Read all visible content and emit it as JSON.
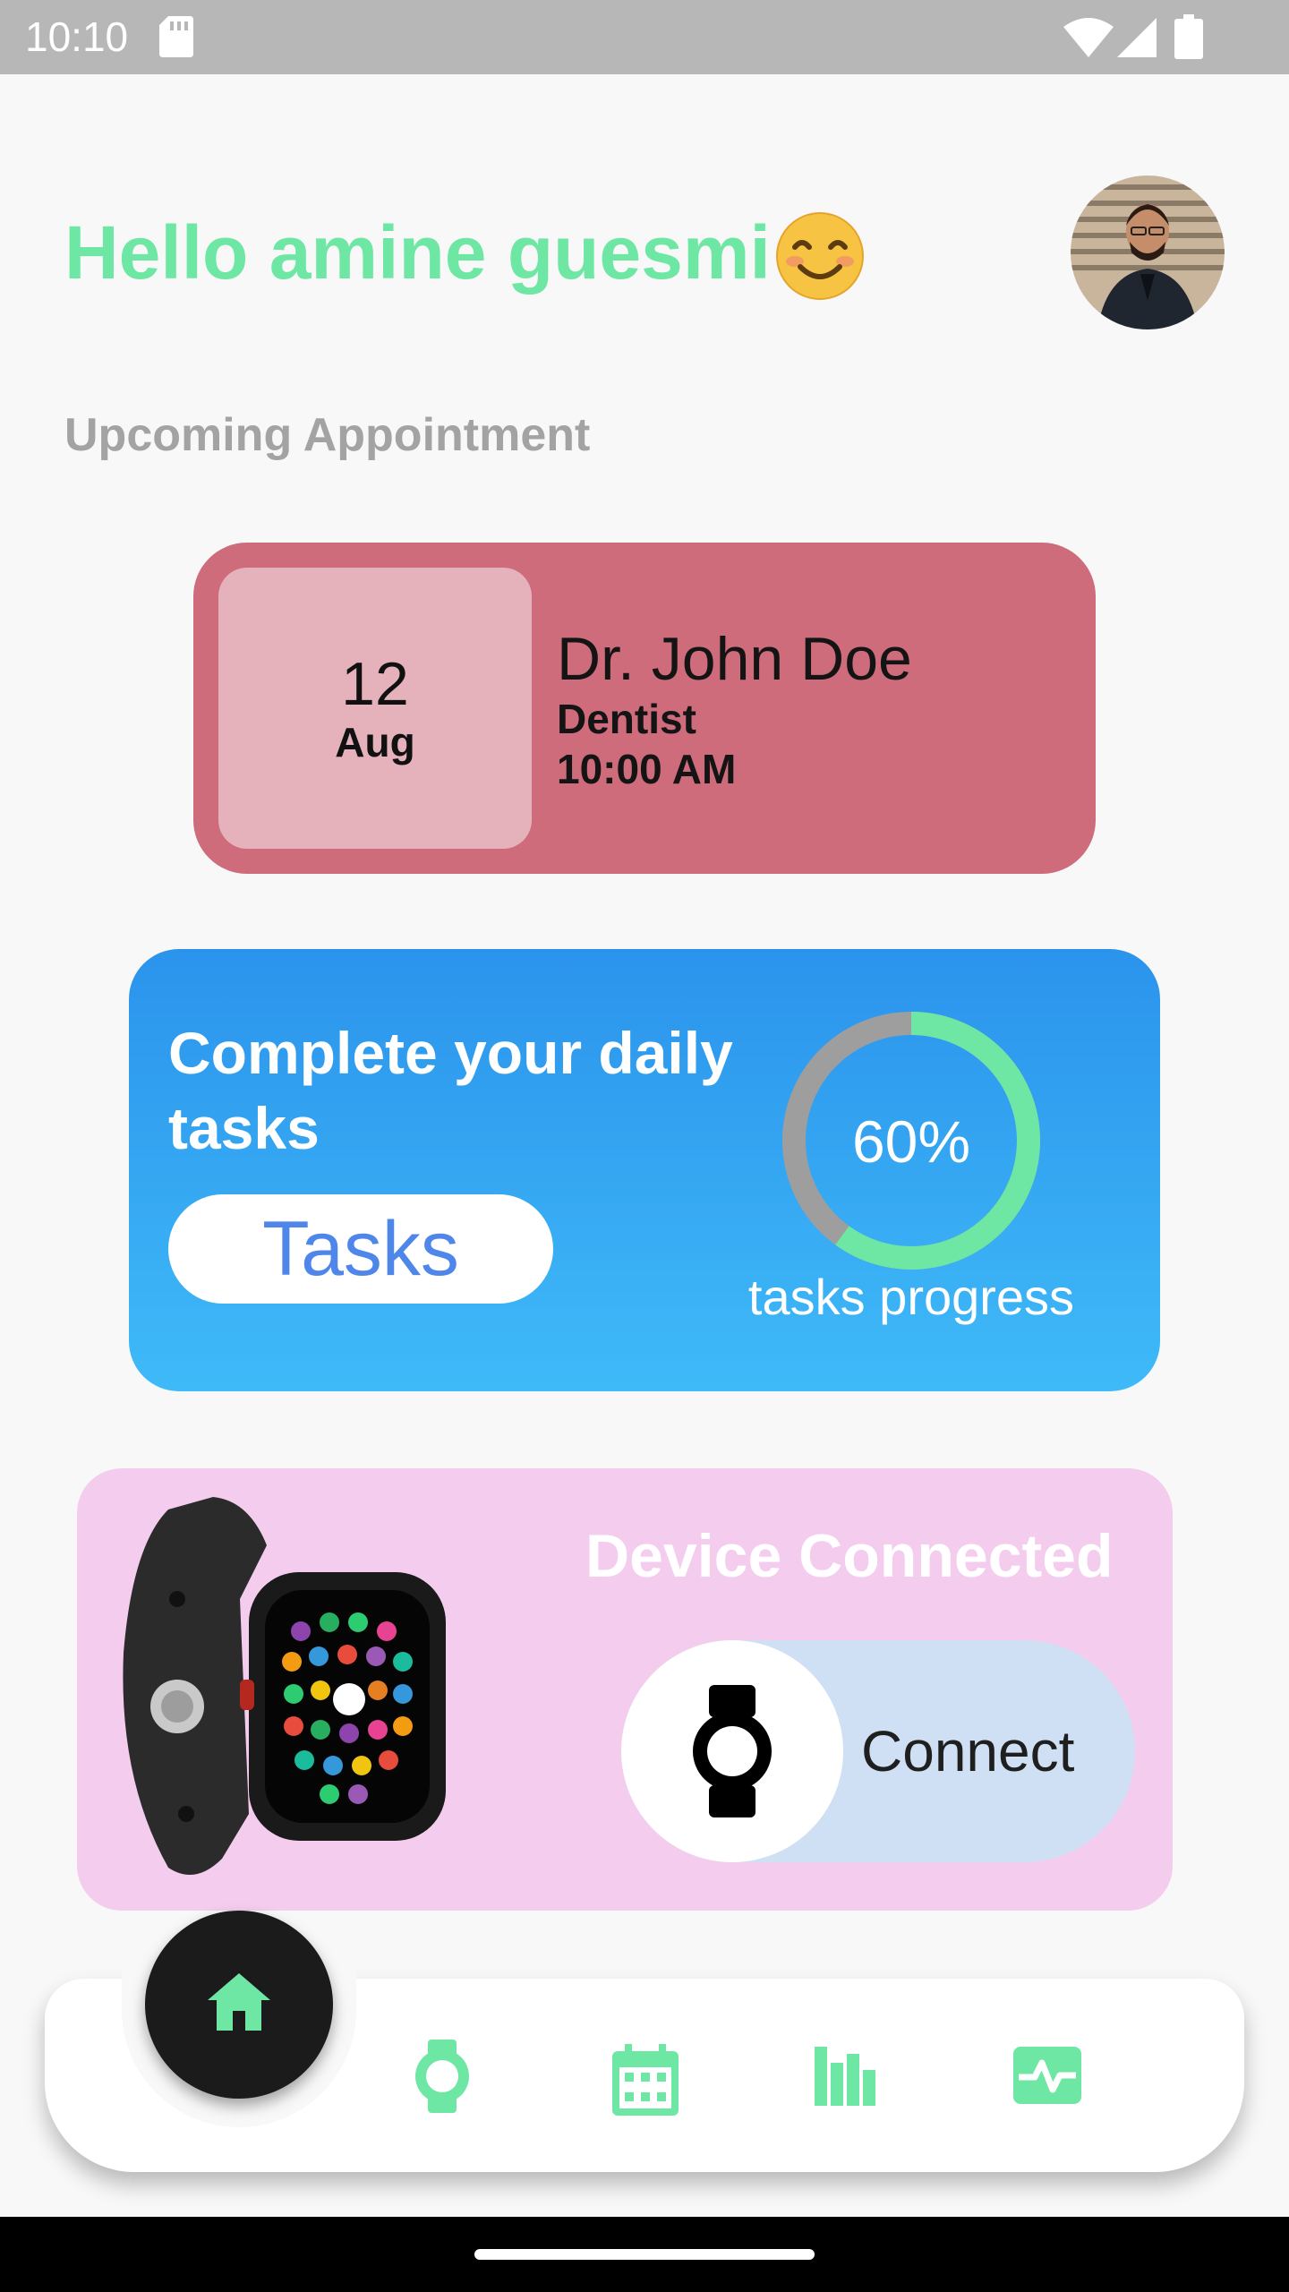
{
  "status_bar": {
    "time": "10:10"
  },
  "header": {
    "greeting": "Hello amine guesmi",
    "emoji": "😊"
  },
  "appointments": {
    "section_title": "Upcoming Appointment",
    "card": {
      "day": "12",
      "month": "Aug",
      "doctor": "Dr. John Doe",
      "specialty": "Dentist",
      "time": "10:00 AM"
    }
  },
  "tasks": {
    "heading": "Complete your daily tasks",
    "button_label": "Tasks",
    "progress_percent": 60,
    "progress_text": "60%",
    "progress_label": "tasks progress"
  },
  "device": {
    "status": "Device Connected",
    "connect_label": "Connect"
  },
  "bottom_nav": {
    "items": [
      "home-icon",
      "watch-icon",
      "calendar-icon",
      "stats-icon",
      "health-icon"
    ],
    "active": "home-icon"
  },
  "colors": {
    "accent_green": "#6ee7a5",
    "appointment_card": "#cf6c7b",
    "tasks_card_top": "#2b93ec",
    "tasks_card_bottom": "#3fbaf8",
    "device_card": "#f4cdee",
    "tasks_button_text": "#4f86ea"
  }
}
